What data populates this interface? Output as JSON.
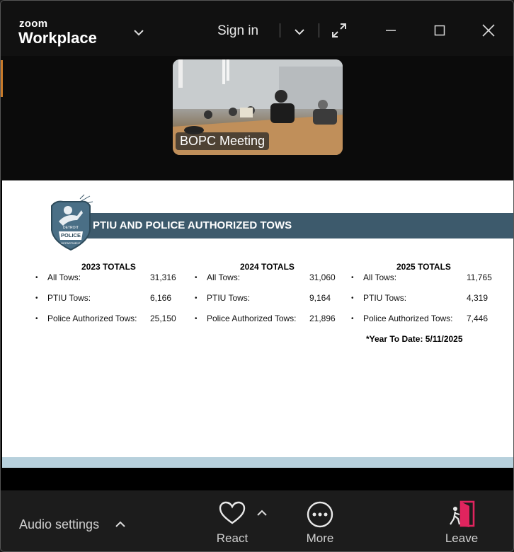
{
  "app": {
    "brand_small": "zoom",
    "brand_large": "Workplace",
    "sign_in": "Sign in"
  },
  "video": {
    "participant_label": "BOPC Meeting"
  },
  "slide": {
    "title": "PTIU AND POLICE AUTHORIZED TOWS",
    "badge_text": [
      "DETROIT",
      "POLICE",
      "DEPARTMENT"
    ],
    "columns": [
      {
        "heading": "2023 TOTALS",
        "rows": [
          {
            "label": "All Tows:",
            "value": "31,316"
          },
          {
            "label": "PTIU Tows:",
            "value": "6,166"
          },
          {
            "label": "Police Authorized Tows:",
            "value": "25,150"
          }
        ]
      },
      {
        "heading": "2024 TOTALS",
        "rows": [
          {
            "label": "All Tows:",
            "value": "31,060"
          },
          {
            "label": "PTIU Tows:",
            "value": "9,164"
          },
          {
            "label": "Police Authorized Tows:",
            "value": "21,896"
          }
        ]
      },
      {
        "heading": "2025 TOTALS",
        "rows": [
          {
            "label": "All Tows:",
            "value": "11,765"
          },
          {
            "label": "PTIU Tows:",
            "value": "4,319"
          },
          {
            "label": "Police Authorized Tows:",
            "value": "7,446"
          }
        ]
      }
    ],
    "footnote": "*Year To Date: 5/11/2025"
  },
  "toolbar": {
    "audio_settings": "Audio settings",
    "react": "React",
    "more": "More",
    "leave": "Leave"
  },
  "colors": {
    "banner": "#3d5a6c",
    "leave_icon": "#e0245e"
  }
}
